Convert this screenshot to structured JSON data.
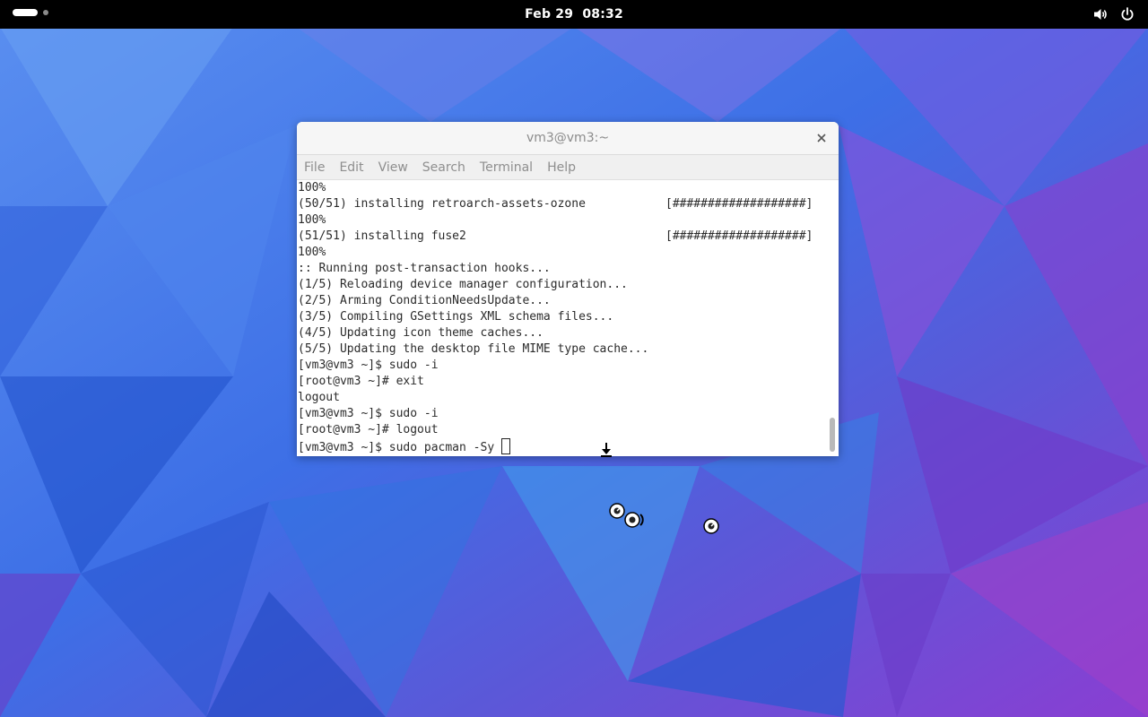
{
  "topbar": {
    "date": "Feb 29",
    "time": "08:32",
    "icons": [
      "activities-indicator",
      "volume-icon",
      "power-icon"
    ]
  },
  "window": {
    "title": "vm3@vm3:~",
    "menu": [
      "File",
      "Edit",
      "View",
      "Search",
      "Terminal",
      "Help"
    ],
    "lines": [
      {
        "left": "100%",
        "right": ""
      },
      {
        "left": "(50/51) installing retroarch-assets-ozone",
        "right": "[###################]"
      },
      {
        "left": "100%",
        "right": ""
      },
      {
        "left": "(51/51) installing fuse2",
        "right": "[###################]"
      },
      {
        "left": "100%",
        "right": ""
      },
      {
        "left": ":: Running post-transaction hooks...",
        "right": ""
      },
      {
        "left": "(1/5) Reloading device manager configuration...",
        "right": ""
      },
      {
        "left": "(2/5) Arming ConditionNeedsUpdate...",
        "right": ""
      },
      {
        "left": "(3/5) Compiling GSettings XML schema files...",
        "right": ""
      },
      {
        "left": "(4/5) Updating icon theme caches...",
        "right": ""
      },
      {
        "left": "(5/5) Updating the desktop file MIME type cache...",
        "right": ""
      },
      {
        "left": "[vm3@vm3 ~]$ sudo -i",
        "right": ""
      },
      {
        "left": "[root@vm3 ~]# exit",
        "right": ""
      },
      {
        "left": "logout",
        "right": ""
      },
      {
        "left": "[vm3@vm3 ~]$ sudo -i",
        "right": ""
      },
      {
        "left": "[root@vm3 ~]# logout",
        "right": ""
      }
    ],
    "prompt": "[vm3@vm3 ~]$ sudo pacman -Sy "
  },
  "colors": {
    "topbar": "#000000",
    "wallpaper_primary": "#3f7be8",
    "wallpaper_secondary": "#8c3fd0"
  }
}
